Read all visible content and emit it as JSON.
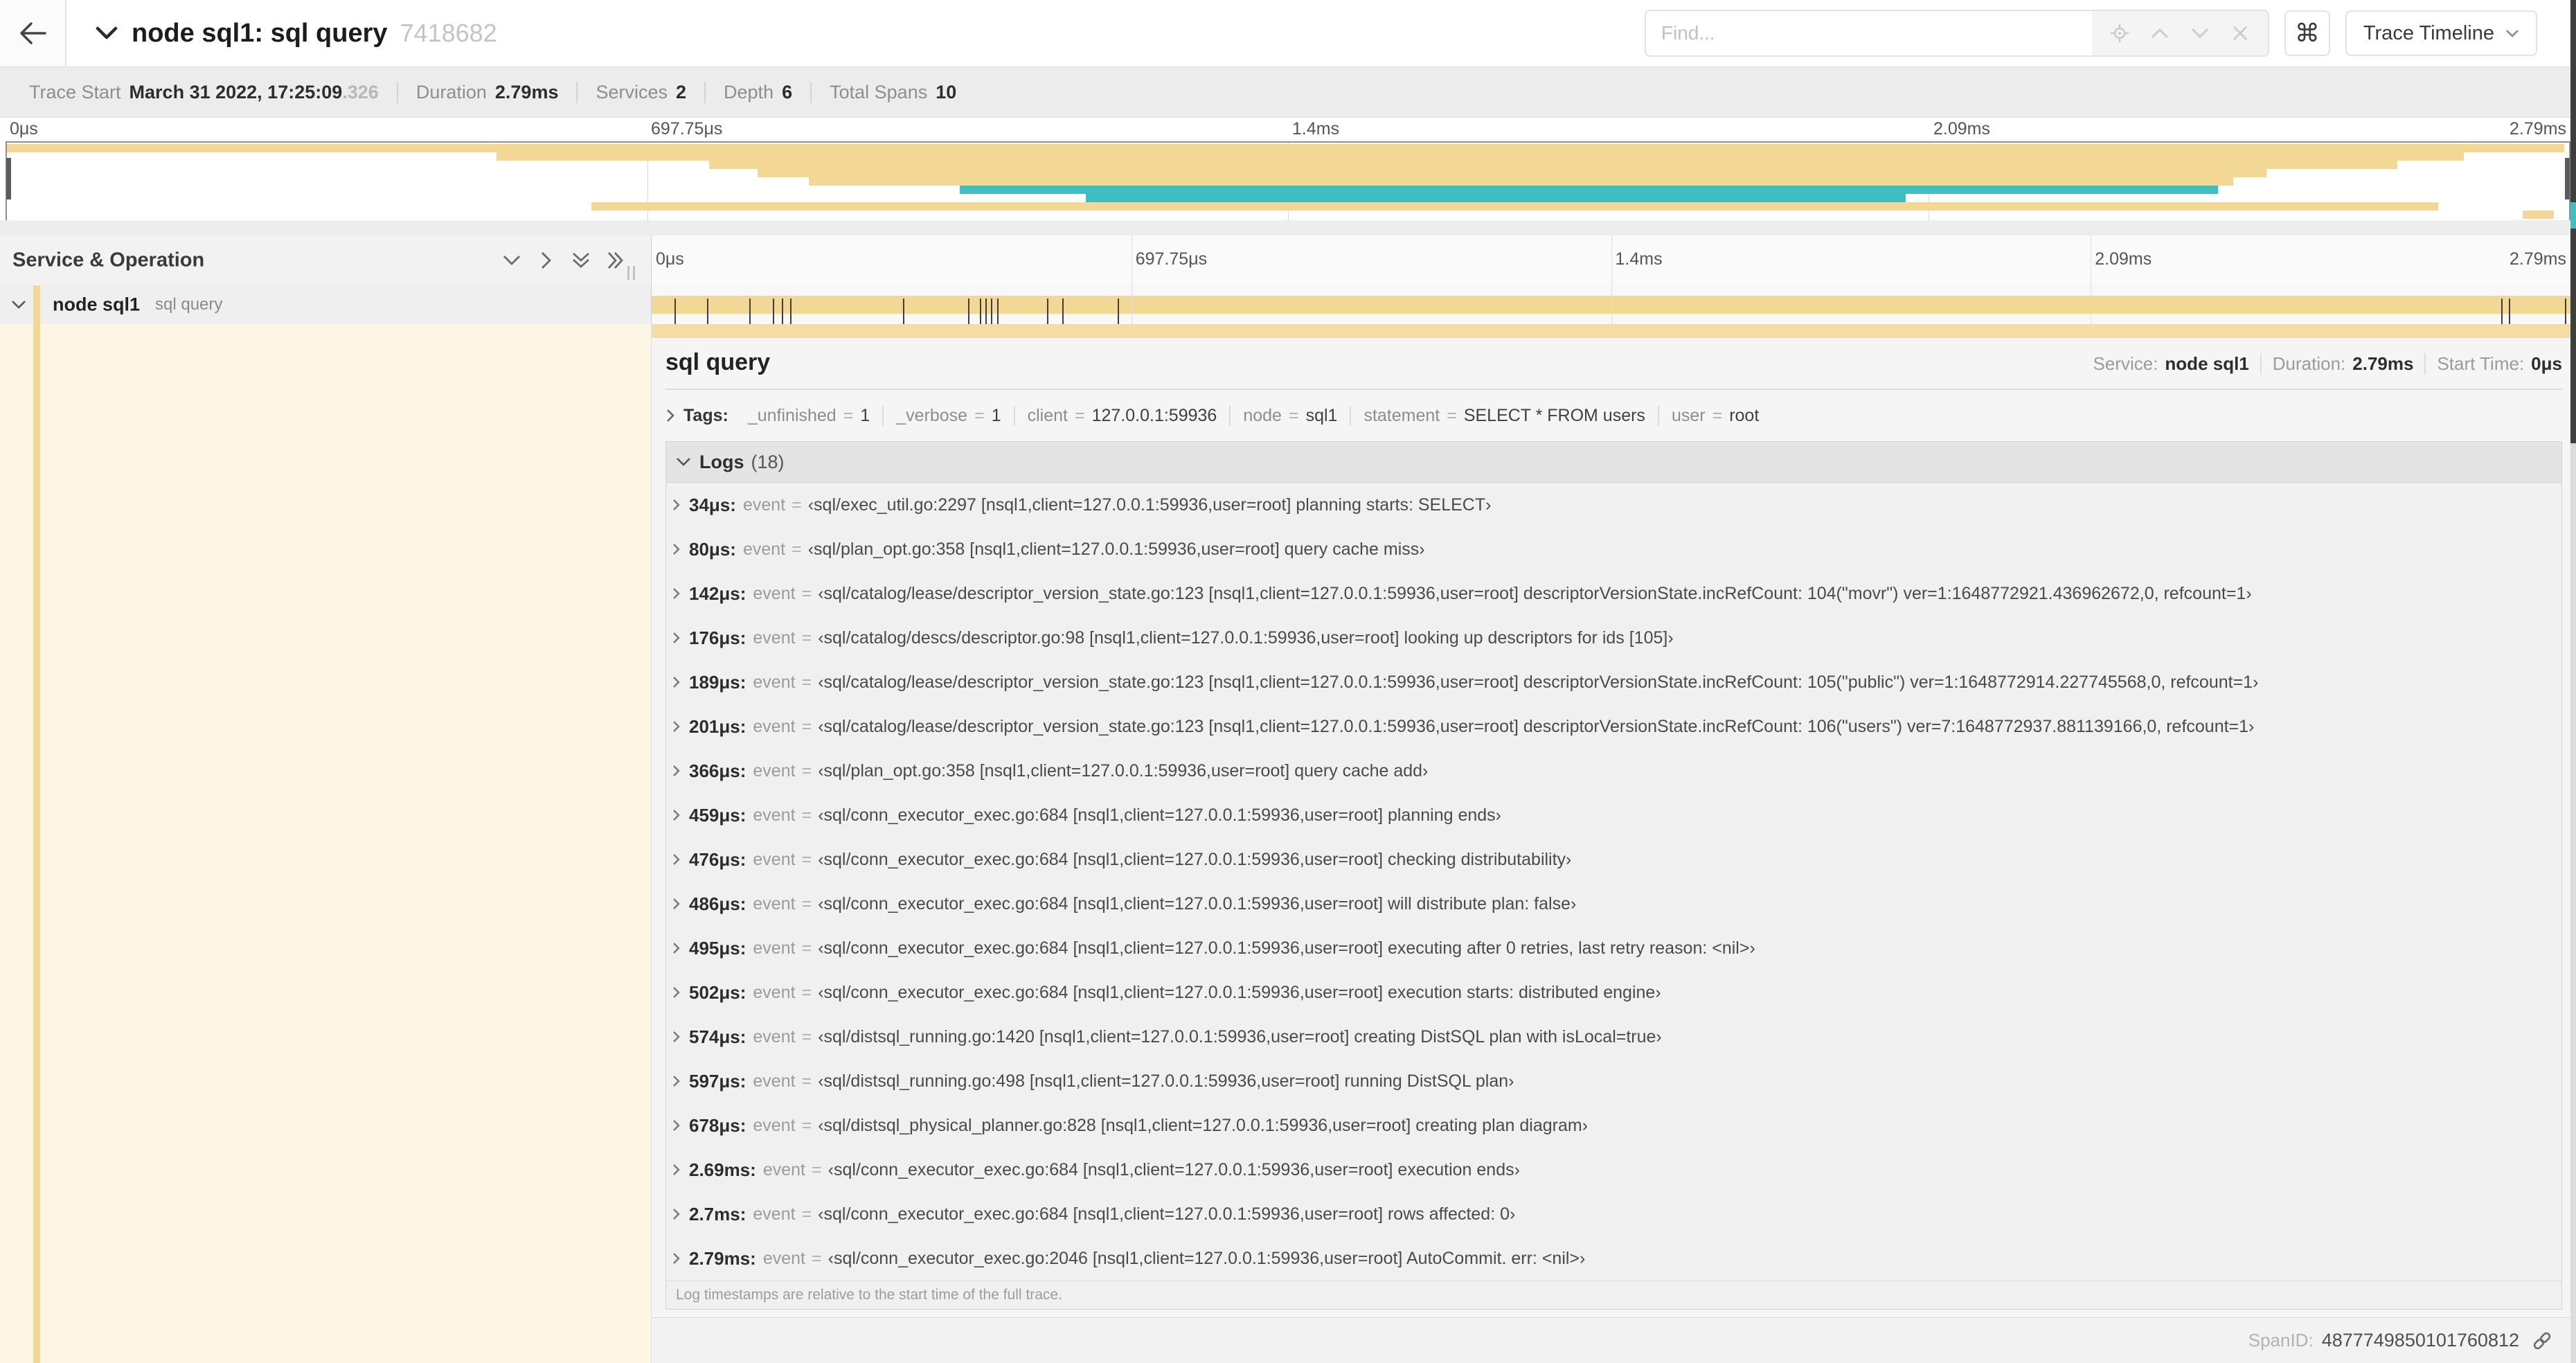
{
  "colors": {
    "tan": "#f3d795",
    "tan_light": "#f5dca4",
    "teal": "#3fbfc4",
    "cream": "#fdf6e4"
  },
  "topbar": {
    "title": "node sql1: sql query",
    "trace_id": "7418682",
    "find_placeholder": "Find...",
    "command_glyph": "⌘",
    "view_selector": "Trace Timeline"
  },
  "summary": {
    "items": [
      {
        "label": "Trace Start",
        "value": "March 31 2022, 17:25:09",
        "muted_suffix": ".326"
      },
      {
        "label": "Duration",
        "value": "2.79ms"
      },
      {
        "label": "Services",
        "value": "2"
      },
      {
        "label": "Depth",
        "value": "6"
      },
      {
        "label": "Total Spans",
        "value": "10"
      }
    ]
  },
  "timeline": {
    "ticks": [
      "0μs",
      "697.75μs",
      "1.4ms",
      "2.09ms",
      "2.79ms"
    ],
    "tick_positions_pct": [
      0,
      25,
      50,
      75,
      100
    ]
  },
  "minimap": {
    "spans": [
      {
        "start": 0,
        "end": 99.8,
        "color": "tan"
      },
      {
        "start": 19.1,
        "end": 95.9,
        "color": "tan"
      },
      {
        "start": 27.4,
        "end": 93.3,
        "color": "tan"
      },
      {
        "start": 29.3,
        "end": 88.2,
        "color": "tan"
      },
      {
        "start": 31.3,
        "end": 86.9,
        "color": "tan"
      },
      {
        "start": 37.2,
        "end": 86.3,
        "color": "teal"
      },
      {
        "start": 42.1,
        "end": 74.1,
        "color": "teal"
      },
      {
        "start": 22.8,
        "end": 94.9,
        "color": "tan"
      },
      {
        "start": 98.2,
        "end": 99.4,
        "color": "tan"
      }
    ]
  },
  "span_table": {
    "header": "Service & Operation",
    "row": {
      "service": "node sql1",
      "operation": "sql query"
    },
    "log_marks_pct": [
      1.2,
      2.9,
      5.1,
      6.3,
      6.8,
      7.2,
      13.1,
      16.5,
      17.1,
      17.4,
      17.7,
      18.0,
      20.6,
      21.4,
      24.3,
      96.4,
      96.8,
      99.7
    ]
  },
  "detail": {
    "title": "sql query",
    "meta": [
      {
        "label": "Service:",
        "value": "node sql1"
      },
      {
        "label": "Duration:",
        "value": "2.79ms"
      },
      {
        "label": "Start Time:",
        "value": "0μs"
      }
    ],
    "tags_label": "Tags:",
    "tags": [
      {
        "key": "_unfinished",
        "value": "1"
      },
      {
        "key": "_verbose",
        "value": "1"
      },
      {
        "key": "client",
        "value": "127.0.0.1:59936"
      },
      {
        "key": "node",
        "value": "sql1"
      },
      {
        "key": "statement",
        "value": "SELECT * FROM users"
      },
      {
        "key": "user",
        "value": "root"
      }
    ]
  },
  "logs": {
    "label": "Logs",
    "count": "(18)",
    "event_key": "event",
    "entries": [
      {
        "time": "34μs:",
        "message": "sql/exec_util.go:2297 [nsql1,client=127.0.0.1:59936,user=root] planning starts: SELECT"
      },
      {
        "time": "80μs:",
        "message": "sql/plan_opt.go:358 [nsql1,client=127.0.0.1:59936,user=root] query cache miss"
      },
      {
        "time": "142μs:",
        "message": "sql/catalog/lease/descriptor_version_state.go:123 [nsql1,client=127.0.0.1:59936,user=root] descriptorVersionState.incRefCount: 104(\"movr\") ver=1:1648772921.436962672,0, refcount=1"
      },
      {
        "time": "176μs:",
        "message": "sql/catalog/descs/descriptor.go:98 [nsql1,client=127.0.0.1:59936,user=root] looking up descriptors for ids [105]"
      },
      {
        "time": "189μs:",
        "message": "sql/catalog/lease/descriptor_version_state.go:123 [nsql1,client=127.0.0.1:59936,user=root] descriptorVersionState.incRefCount: 105(\"public\") ver=1:1648772914.227745568,0, refcount=1"
      },
      {
        "time": "201μs:",
        "message": "sql/catalog/lease/descriptor_version_state.go:123 [nsql1,client=127.0.0.1:59936,user=root] descriptorVersionState.incRefCount: 106(\"users\") ver=7:1648772937.881139166,0, refcount=1"
      },
      {
        "time": "366μs:",
        "message": "sql/plan_opt.go:358 [nsql1,client=127.0.0.1:59936,user=root] query cache add"
      },
      {
        "time": "459μs:",
        "message": "sql/conn_executor_exec.go:684 [nsql1,client=127.0.0.1:59936,user=root] planning ends"
      },
      {
        "time": "476μs:",
        "message": "sql/conn_executor_exec.go:684 [nsql1,client=127.0.0.1:59936,user=root] checking distributability"
      },
      {
        "time": "486μs:",
        "message": "sql/conn_executor_exec.go:684 [nsql1,client=127.0.0.1:59936,user=root] will distribute plan: false"
      },
      {
        "time": "495μs:",
        "message": "sql/conn_executor_exec.go:684 [nsql1,client=127.0.0.1:59936,user=root] executing after 0 retries, last retry reason: <nil>"
      },
      {
        "time": "502μs:",
        "message": "sql/conn_executor_exec.go:684 [nsql1,client=127.0.0.1:59936,user=root] execution starts: distributed engine"
      },
      {
        "time": "574μs:",
        "message": "sql/distsql_running.go:1420 [nsql1,client=127.0.0.1:59936,user=root] creating DistSQL plan with isLocal=true"
      },
      {
        "time": "597μs:",
        "message": "sql/distsql_running.go:498 [nsql1,client=127.0.0.1:59936,user=root] running DistSQL plan"
      },
      {
        "time": "678μs:",
        "message": "sql/distsql_physical_planner.go:828 [nsql1,client=127.0.0.1:59936,user=root] creating plan diagram"
      },
      {
        "time": "2.69ms:",
        "message": "sql/conn_executor_exec.go:684 [nsql1,client=127.0.0.1:59936,user=root] execution ends"
      },
      {
        "time": "2.7ms:",
        "message": "sql/conn_executor_exec.go:684 [nsql1,client=127.0.0.1:59936,user=root] rows affected: 0"
      },
      {
        "time": "2.79ms:",
        "message": "sql/conn_executor_exec.go:2046 [nsql1,client=127.0.0.1:59936,user=root] AutoCommit. err: <nil>"
      }
    ],
    "footnote": "Log timestamps are relative to the start time of the full trace."
  },
  "footer": {
    "span_id_label": "SpanID:",
    "span_id": "4877749850101760812"
  }
}
